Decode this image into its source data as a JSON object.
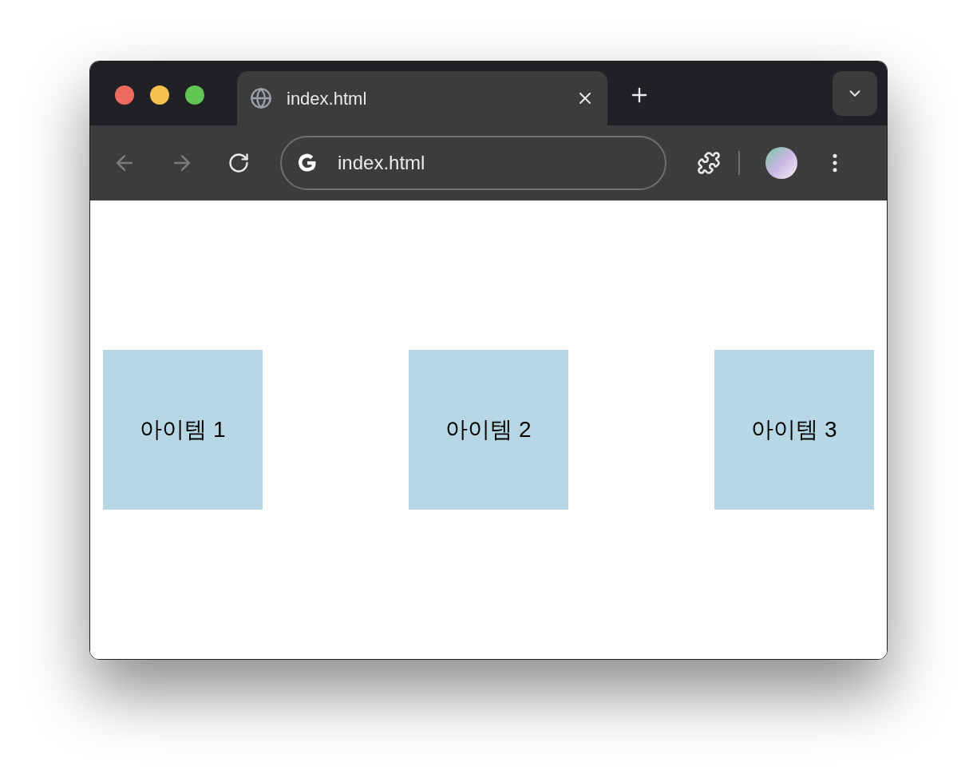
{
  "tab": {
    "title": "index.html"
  },
  "navigation": {
    "back_disabled": true,
    "forward_disabled": true
  },
  "address_bar": {
    "value": "index.html"
  },
  "items": [
    {
      "label": "아이템 1"
    },
    {
      "label": "아이템 2"
    },
    {
      "label": "아이템 3"
    }
  ]
}
